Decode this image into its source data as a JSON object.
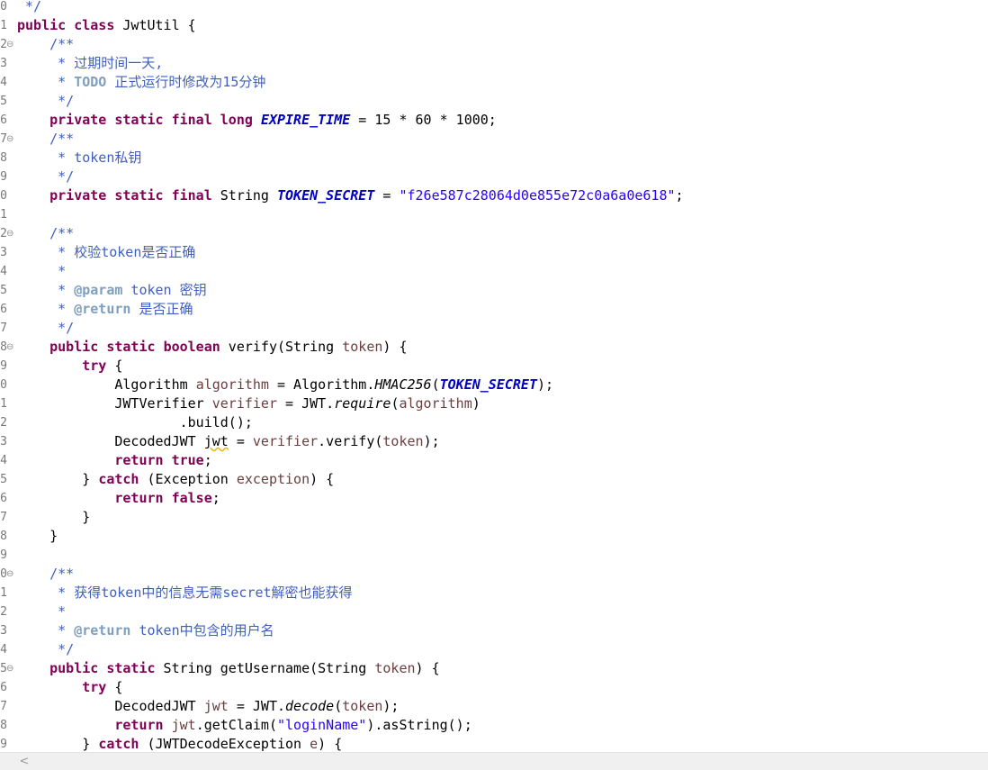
{
  "colors": {
    "keyword": "#7f0055",
    "comment": "#3f5fbf",
    "javadoc_tag": "#7f9fbf",
    "string": "#2a00ff",
    "static_field": "#0000c0",
    "local_variable": "#6a3e3e",
    "line_number": "#787878",
    "background": "#ffffff"
  },
  "scrollbar": {
    "left_arrow": "<"
  },
  "lines": [
    {
      "n": "0",
      "fold": "",
      "tokens": [
        [
          "com",
          " */"
        ]
      ]
    },
    {
      "n": "1",
      "fold": "",
      "tokens": [
        [
          "kw",
          "public"
        ],
        [
          "pln",
          " "
        ],
        [
          "kw",
          "class"
        ],
        [
          "pln",
          " JwtUtil {"
        ]
      ]
    },
    {
      "n": "2",
      "fold": "⊖",
      "tokens": [
        [
          "pln",
          "    "
        ],
        [
          "com",
          "/**"
        ]
      ]
    },
    {
      "n": "3",
      "fold": "",
      "tokens": [
        [
          "com",
          "     * 过期时间一天,"
        ]
      ]
    },
    {
      "n": "4",
      "fold": "",
      "tokens": [
        [
          "com",
          "     * "
        ],
        [
          "todo",
          "TODO"
        ],
        [
          "com",
          " 正式运行时修改为15分钟"
        ]
      ]
    },
    {
      "n": "5",
      "fold": "",
      "tokens": [
        [
          "com",
          "     */"
        ]
      ]
    },
    {
      "n": "6",
      "fold": "",
      "tokens": [
        [
          "pln",
          "    "
        ],
        [
          "kw",
          "private"
        ],
        [
          "pln",
          " "
        ],
        [
          "kw",
          "static"
        ],
        [
          "pln",
          " "
        ],
        [
          "kw",
          "final"
        ],
        [
          "pln",
          " "
        ],
        [
          "kw",
          "long"
        ],
        [
          "pln",
          " "
        ],
        [
          "fld",
          "EXPIRE_TIME"
        ],
        [
          "pln",
          " = 15 * 60 * 1000;"
        ]
      ]
    },
    {
      "n": "7",
      "fold": "⊖",
      "tokens": [
        [
          "pln",
          "    "
        ],
        [
          "com",
          "/**"
        ]
      ]
    },
    {
      "n": "8",
      "fold": "",
      "tokens": [
        [
          "com",
          "     * token私钥"
        ]
      ]
    },
    {
      "n": "9",
      "fold": "",
      "tokens": [
        [
          "com",
          "     */"
        ]
      ]
    },
    {
      "n": "0",
      "fold": "",
      "tokens": [
        [
          "pln",
          "    "
        ],
        [
          "kw",
          "private"
        ],
        [
          "pln",
          " "
        ],
        [
          "kw",
          "static"
        ],
        [
          "pln",
          " "
        ],
        [
          "kw",
          "final"
        ],
        [
          "pln",
          " String "
        ],
        [
          "fld",
          "TOKEN_SECRET"
        ],
        [
          "pln",
          " = "
        ],
        [
          "str",
          "\"f26e587c28064d0e855e72c0a6a0e618\""
        ],
        [
          "pln",
          ";"
        ]
      ]
    },
    {
      "n": "1",
      "fold": "",
      "tokens": []
    },
    {
      "n": "2",
      "fold": "⊖",
      "tokens": [
        [
          "pln",
          "    "
        ],
        [
          "com",
          "/**"
        ]
      ]
    },
    {
      "n": "3",
      "fold": "",
      "tokens": [
        [
          "com",
          "     * 校验token是否正确"
        ]
      ]
    },
    {
      "n": "4",
      "fold": "",
      "tokens": [
        [
          "com",
          "     *"
        ]
      ]
    },
    {
      "n": "5",
      "fold": "",
      "tokens": [
        [
          "com",
          "     * "
        ],
        [
          "tag",
          "@param"
        ],
        [
          "com",
          " token 密钥"
        ]
      ]
    },
    {
      "n": "6",
      "fold": "",
      "tokens": [
        [
          "com",
          "     * "
        ],
        [
          "tag",
          "@return"
        ],
        [
          "com",
          " 是否正确"
        ]
      ]
    },
    {
      "n": "7",
      "fold": "",
      "tokens": [
        [
          "com",
          "     */"
        ]
      ]
    },
    {
      "n": "8",
      "fold": "⊖",
      "tokens": [
        [
          "pln",
          "    "
        ],
        [
          "kw",
          "public"
        ],
        [
          "pln",
          " "
        ],
        [
          "kw",
          "static"
        ],
        [
          "pln",
          " "
        ],
        [
          "kw",
          "boolean"
        ],
        [
          "pln",
          " verify(String "
        ],
        [
          "var",
          "token"
        ],
        [
          "pln",
          ") {"
        ]
      ]
    },
    {
      "n": "9",
      "fold": "",
      "tokens": [
        [
          "pln",
          "        "
        ],
        [
          "kw",
          "try"
        ],
        [
          "pln",
          " {"
        ]
      ]
    },
    {
      "n": "0",
      "fold": "",
      "tokens": [
        [
          "pln",
          "            Algorithm "
        ],
        [
          "var",
          "algorithm"
        ],
        [
          "pln",
          " = Algorithm."
        ],
        [
          "mth",
          "HMAC256"
        ],
        [
          "pln",
          "("
        ],
        [
          "fld",
          "TOKEN_SECRET"
        ],
        [
          "pln",
          ");"
        ]
      ]
    },
    {
      "n": "1",
      "fold": "",
      "tokens": [
        [
          "pln",
          "            JWTVerifier "
        ],
        [
          "var",
          "verifier"
        ],
        [
          "pln",
          " = JWT."
        ],
        [
          "mth",
          "require"
        ],
        [
          "pln",
          "("
        ],
        [
          "var",
          "algorithm"
        ],
        [
          "pln",
          ")"
        ]
      ]
    },
    {
      "n": "2",
      "fold": "",
      "tokens": [
        [
          "pln",
          "                    .build();"
        ]
      ]
    },
    {
      "n": "3",
      "fold": "",
      "tokens": [
        [
          "pln",
          "            DecodedJWT "
        ],
        [
          "warn",
          "jwt"
        ],
        [
          "pln",
          " = "
        ],
        [
          "var",
          "verifier"
        ],
        [
          "pln",
          ".verify("
        ],
        [
          "var",
          "token"
        ],
        [
          "pln",
          ");"
        ]
      ]
    },
    {
      "n": "4",
      "fold": "",
      "tokens": [
        [
          "pln",
          "            "
        ],
        [
          "kw",
          "return"
        ],
        [
          "pln",
          " "
        ],
        [
          "kw",
          "true"
        ],
        [
          "pln",
          ";"
        ]
      ]
    },
    {
      "n": "5",
      "fold": "",
      "tokens": [
        [
          "pln",
          "        } "
        ],
        [
          "kw",
          "catch"
        ],
        [
          "pln",
          " (Exception "
        ],
        [
          "var",
          "exception"
        ],
        [
          "pln",
          ") {"
        ]
      ]
    },
    {
      "n": "6",
      "fold": "",
      "tokens": [
        [
          "pln",
          "            "
        ],
        [
          "kw",
          "return"
        ],
        [
          "pln",
          " "
        ],
        [
          "kw",
          "false"
        ],
        [
          "pln",
          ";"
        ]
      ]
    },
    {
      "n": "7",
      "fold": "",
      "tokens": [
        [
          "pln",
          "        }"
        ]
      ]
    },
    {
      "n": "8",
      "fold": "",
      "tokens": [
        [
          "pln",
          "    }"
        ]
      ]
    },
    {
      "n": "9",
      "fold": "",
      "tokens": []
    },
    {
      "n": "0",
      "fold": "⊖",
      "tokens": [
        [
          "pln",
          "    "
        ],
        [
          "com",
          "/**"
        ]
      ]
    },
    {
      "n": "1",
      "fold": "",
      "tokens": [
        [
          "com",
          "     * 获得token中的信息无需secret解密也能获得"
        ]
      ]
    },
    {
      "n": "2",
      "fold": "",
      "tokens": [
        [
          "com",
          "     *"
        ]
      ]
    },
    {
      "n": "3",
      "fold": "",
      "tokens": [
        [
          "com",
          "     * "
        ],
        [
          "tag",
          "@return"
        ],
        [
          "com",
          " token中包含的用户名"
        ]
      ]
    },
    {
      "n": "4",
      "fold": "",
      "tokens": [
        [
          "com",
          "     */"
        ]
      ]
    },
    {
      "n": "5",
      "fold": "⊖",
      "tokens": [
        [
          "pln",
          "    "
        ],
        [
          "kw",
          "public"
        ],
        [
          "pln",
          " "
        ],
        [
          "kw",
          "static"
        ],
        [
          "pln",
          " String getUsername(String "
        ],
        [
          "var",
          "token"
        ],
        [
          "pln",
          ") {"
        ]
      ]
    },
    {
      "n": "6",
      "fold": "",
      "tokens": [
        [
          "pln",
          "        "
        ],
        [
          "kw",
          "try"
        ],
        [
          "pln",
          " {"
        ]
      ]
    },
    {
      "n": "7",
      "fold": "",
      "tokens": [
        [
          "pln",
          "            DecodedJWT "
        ],
        [
          "var",
          "jwt"
        ],
        [
          "pln",
          " = JWT."
        ],
        [
          "mth",
          "decode"
        ],
        [
          "pln",
          "("
        ],
        [
          "var",
          "token"
        ],
        [
          "pln",
          ");"
        ]
      ]
    },
    {
      "n": "8",
      "fold": "",
      "tokens": [
        [
          "pln",
          "            "
        ],
        [
          "kw",
          "return"
        ],
        [
          "pln",
          " "
        ],
        [
          "var",
          "jwt"
        ],
        [
          "pln",
          ".getClaim("
        ],
        [
          "str",
          "\"loginName\""
        ],
        [
          "pln",
          ").asString();"
        ]
      ]
    },
    {
      "n": "9",
      "fold": "",
      "tokens": [
        [
          "pln",
          "        } "
        ],
        [
          "kw",
          "catch"
        ],
        [
          "pln",
          " (JWTDecodeException "
        ],
        [
          "var",
          "e"
        ],
        [
          "pln",
          ") {"
        ]
      ]
    }
  ]
}
